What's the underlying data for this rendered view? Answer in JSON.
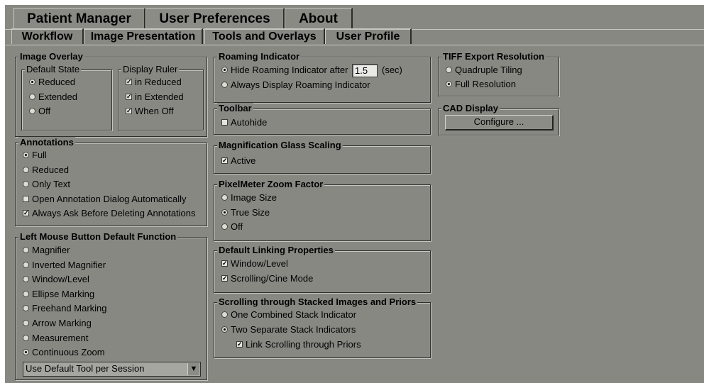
{
  "top_tabs": [
    "Patient Manager",
    "User Preferences",
    "About"
  ],
  "sub_tabs": [
    "Workflow",
    "Image Presentation",
    "Tools and Overlays",
    "User Profile"
  ],
  "image_overlay": {
    "title": "Image Overlay",
    "default_state": {
      "title": "Default State",
      "options": [
        "Reduced",
        "Extended",
        "Off"
      ],
      "selected": "Reduced"
    },
    "display_ruler": {
      "title": "Display Ruler",
      "options": [
        "in Reduced",
        "in Extended",
        "When Off"
      ],
      "checked": [
        true,
        true,
        true
      ]
    }
  },
  "annotations": {
    "title": "Annotations",
    "radios": [
      "Full",
      "Reduced",
      "Only Text"
    ],
    "selected": "Full",
    "checks": [
      "Open Annotation Dialog Automatically",
      "Always Ask Before Deleting Annotations"
    ],
    "checked": [
      false,
      true
    ]
  },
  "left_mouse": {
    "title": "Left Mouse Button Default Function",
    "options": [
      "Magnifier",
      "Inverted Magnifier",
      "Window/Level",
      "Ellipse Marking",
      "Freehand Marking",
      "Arrow Marking",
      "Measurement",
      "Continuous Zoom"
    ],
    "selected": "Continuous Zoom",
    "dropdown_value": "Use Default Tool per Session"
  },
  "roaming": {
    "title": "Roaming Indicator",
    "hide_label": "Hide Roaming Indicator after",
    "seconds": "1.5",
    "unit": "(sec)",
    "always_label": "Always Display Roaming Indicator",
    "selected": "hide"
  },
  "toolbar": {
    "title": "Toolbar",
    "autohide_label": "Autohide",
    "autohide": false
  },
  "magnification": {
    "title": "Magnification Glass Scaling",
    "active_label": "Active",
    "active": true
  },
  "pixelmeter": {
    "title": "PixelMeter Zoom Factor",
    "options": [
      "Image Size",
      "True Size",
      "Off"
    ],
    "selected": "True Size"
  },
  "linking": {
    "title": "Default Linking Properties",
    "options": [
      "Window/Level",
      "Scrolling/Cine Mode"
    ],
    "checked": [
      true,
      true
    ]
  },
  "scrolling": {
    "title": "Scrolling through Stacked Images and Priors",
    "options": [
      "One Combined Stack Indicator",
      "Two Separate Stack Indicators"
    ],
    "selected": "Two Separate Stack Indicators",
    "link_label": "Link Scrolling through Priors",
    "link_checked": true
  },
  "tiff": {
    "title": "TIFF Export Resolution",
    "options": [
      "Quadruple Tiling",
      "Full Resolution"
    ],
    "selected": "Full Resolution"
  },
  "cad": {
    "title": "CAD Display",
    "configure_label": "Configure ..."
  },
  "icons": {
    "checkmark": "✓",
    "dropdown_arrow": "▼"
  }
}
